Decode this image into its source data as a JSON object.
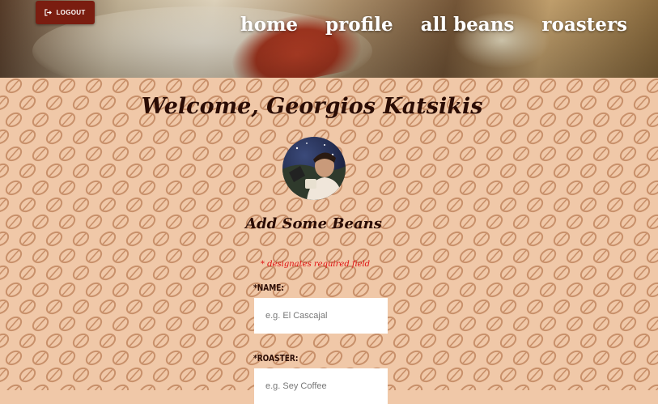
{
  "header": {
    "logout_label": "LOGOUT",
    "nav": [
      {
        "label": "home"
      },
      {
        "label": "profile"
      },
      {
        "label": "all beans"
      },
      {
        "label": "roasters"
      }
    ]
  },
  "main": {
    "welcome": "Welcome, Georgios Katsikis",
    "form_title": "Add Some Beans",
    "required_note": "* designates required field",
    "fields": [
      {
        "label": "*NAME:",
        "placeholder": "e.g. El Cascajal"
      },
      {
        "label": "*ROASTER:",
        "placeholder": "e.g. Sey Coffee"
      }
    ]
  },
  "colors": {
    "background": "#f0c8a8",
    "bean_pattern": "#c8906a",
    "logout_button": "#7a1d10",
    "heading": "#2a0c05",
    "required": "#e01010"
  },
  "icons": {
    "logout": "logout-icon",
    "pattern": "coffee-bean-icon"
  }
}
